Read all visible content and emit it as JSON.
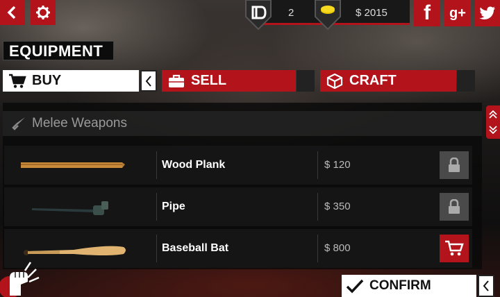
{
  "top_left": {
    "back_icon": "chevron-left-icon",
    "settings_icon": "gear-icon"
  },
  "counters": {
    "level_value": "2",
    "money_value": "$ 2015"
  },
  "social": {
    "facebook_label": "f",
    "google_label": "g+",
    "twitter_icon": "twitter-icon"
  },
  "screen_title": "EQUIPMENT",
  "tabs": [
    {
      "label": "BUY",
      "icon": "cart-icon",
      "active": true
    },
    {
      "label": "SELL",
      "icon": "briefcase-icon",
      "active": false
    },
    {
      "label": "CRAFT",
      "icon": "cube-icon",
      "active": false
    }
  ],
  "section": {
    "label": "Melee Weapons",
    "icon": "knife-icon"
  },
  "items": [
    {
      "name": "Wood Plank",
      "price": "$ 120",
      "status": "locked"
    },
    {
      "name": "Pipe",
      "price": "$ 350",
      "status": "locked"
    },
    {
      "name": "Baseball Bat",
      "price": "$ 800",
      "status": "buy"
    }
  ],
  "confirm_label": "CONFIRM",
  "colors": {
    "accent": "#b3141c",
    "panel": "#161616",
    "locked": "#4a4a4a"
  }
}
